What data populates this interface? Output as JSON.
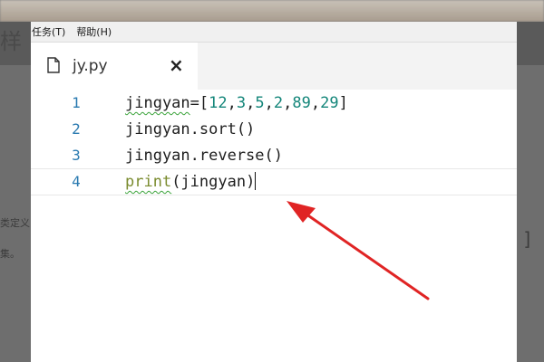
{
  "background": {
    "ghost_title": "样",
    "ghost_line_1": "类定义",
    "ghost_line_2": "集。",
    "ghost_bracket": "]"
  },
  "menu": {
    "items": [
      {
        "label": "任务(T)"
      },
      {
        "label": "帮助(H)"
      }
    ]
  },
  "tab": {
    "title": "jy.py",
    "close_label": "×"
  },
  "editor": {
    "lines": [
      {
        "number": "1",
        "text": "jingyan=[12,3,5,2,89,29]"
      },
      {
        "number": "2",
        "text": "jingyan.sort()"
      },
      {
        "number": "3",
        "text": "jingyan.reverse()"
      },
      {
        "number": "4",
        "text": "print(jingyan)"
      }
    ],
    "current_line": 4
  },
  "colors": {
    "number": "#14867a",
    "builtin": "#7a8b2e",
    "line_number": "#2a7ab0",
    "annotation_arrow": "#e02424"
  },
  "icons": {
    "file": "file-icon",
    "close": "close-icon",
    "annotation": "arrow-icon"
  }
}
